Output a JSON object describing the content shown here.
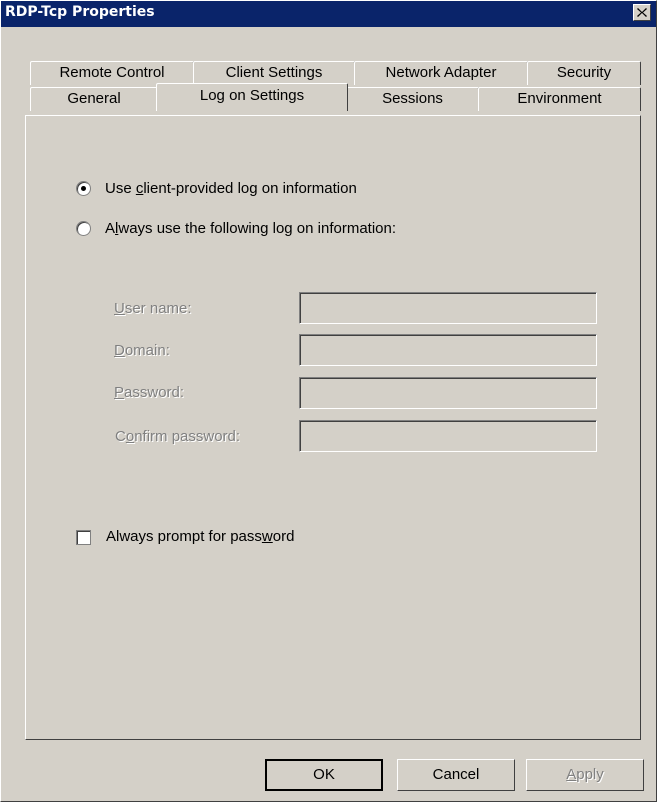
{
  "window": {
    "title": "RDP-Tcp Properties"
  },
  "tabs_row1": [
    "Remote Control",
    "Client Settings",
    "Network Adapter",
    "Security"
  ],
  "tabs_row2": [
    "General",
    "Log on Settings",
    "Sessions",
    "Environment"
  ],
  "active_tab": "Log on Settings",
  "options": {
    "use_client": {
      "pre": "Use ",
      "key": "c",
      "post": "lient-provided log on information",
      "selected": true
    },
    "always_use": {
      "pre": "A",
      "key": "l",
      "post": "ways use the following log on information:",
      "selected": false
    }
  },
  "fields": [
    {
      "key": "U",
      "rest": "ser name:",
      "value": ""
    },
    {
      "key": "D",
      "rest": "omain:",
      "value": ""
    },
    {
      "key": "P",
      "rest": "assword:",
      "value": ""
    },
    {
      "pre": "C",
      "key": "o",
      "rest": "nfirm password:",
      "value": ""
    }
  ],
  "prompt_password": {
    "pre": "Always prompt for pass",
    "key": "w",
    "post": "ord",
    "checked": false
  },
  "buttons": {
    "ok": "OK",
    "cancel": "Cancel",
    "apply_key": "A",
    "apply_rest": "pply"
  }
}
